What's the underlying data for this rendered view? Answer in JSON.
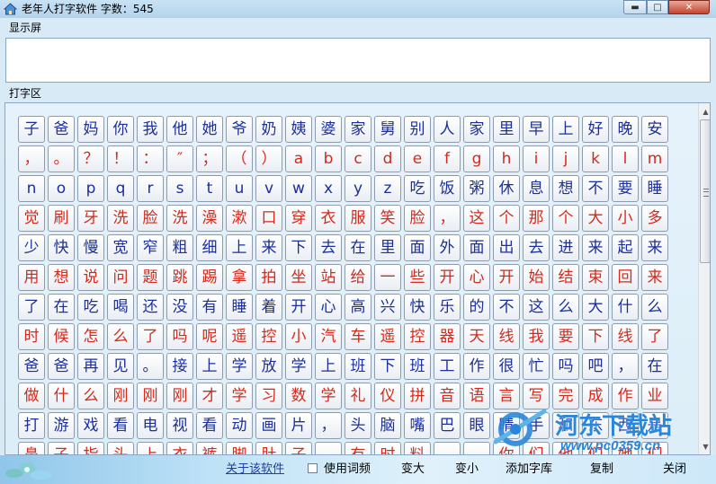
{
  "window": {
    "title": "老年人打字软件  字数：545",
    "min_glyph": "▬",
    "max_glyph": "□",
    "close_glyph": "✕"
  },
  "display_section": {
    "label": "显示屏",
    "text": ""
  },
  "typing_section": {
    "label": "打字区"
  },
  "keys": [
    {
      "t": "子",
      "c": "blue"
    },
    {
      "t": "爸",
      "c": "blue"
    },
    {
      "t": "妈",
      "c": "blue"
    },
    {
      "t": "你",
      "c": "blue"
    },
    {
      "t": "我",
      "c": "blue"
    },
    {
      "t": "他",
      "c": "blue"
    },
    {
      "t": "她",
      "c": "blue"
    },
    {
      "t": "爷",
      "c": "blue"
    },
    {
      "t": "奶",
      "c": "blue"
    },
    {
      "t": "姨",
      "c": "blue"
    },
    {
      "t": "婆",
      "c": "blue"
    },
    {
      "t": "家",
      "c": "blue"
    },
    {
      "t": "舅",
      "c": "blue"
    },
    {
      "t": "别",
      "c": "blue"
    },
    {
      "t": "人",
      "c": "blue"
    },
    {
      "t": "家",
      "c": "blue"
    },
    {
      "t": "里",
      "c": "blue"
    },
    {
      "t": "早",
      "c": "blue"
    },
    {
      "t": "上",
      "c": "blue"
    },
    {
      "t": "好",
      "c": "blue"
    },
    {
      "t": "晚",
      "c": "blue"
    },
    {
      "t": "安",
      "c": "blue"
    },
    {
      "t": "，",
      "c": "red"
    },
    {
      "t": "。",
      "c": "red"
    },
    {
      "t": "？",
      "c": "red"
    },
    {
      "t": "！",
      "c": "red"
    },
    {
      "t": "：",
      "c": "red"
    },
    {
      "t": "″",
      "c": "red"
    },
    {
      "t": "；",
      "c": "red"
    },
    {
      "t": "（",
      "c": "red"
    },
    {
      "t": "）",
      "c": "red"
    },
    {
      "t": "a",
      "c": "red"
    },
    {
      "t": "b",
      "c": "red"
    },
    {
      "t": "c",
      "c": "red"
    },
    {
      "t": "d",
      "c": "red"
    },
    {
      "t": "e",
      "c": "red"
    },
    {
      "t": "f",
      "c": "red"
    },
    {
      "t": "g",
      "c": "red"
    },
    {
      "t": "h",
      "c": "red"
    },
    {
      "t": "i",
      "c": "red"
    },
    {
      "t": "j",
      "c": "red"
    },
    {
      "t": "k",
      "c": "red"
    },
    {
      "t": "l",
      "c": "red"
    },
    {
      "t": "m",
      "c": "red"
    },
    {
      "t": "n",
      "c": "blue"
    },
    {
      "t": "o",
      "c": "blue"
    },
    {
      "t": "p",
      "c": "blue"
    },
    {
      "t": "q",
      "c": "blue"
    },
    {
      "t": "r",
      "c": "blue"
    },
    {
      "t": "s",
      "c": "blue"
    },
    {
      "t": "t",
      "c": "blue"
    },
    {
      "t": "u",
      "c": "blue"
    },
    {
      "t": "v",
      "c": "blue"
    },
    {
      "t": "w",
      "c": "blue"
    },
    {
      "t": "x",
      "c": "blue"
    },
    {
      "t": "y",
      "c": "blue"
    },
    {
      "t": "z",
      "c": "blue"
    },
    {
      "t": "吃",
      "c": "blue"
    },
    {
      "t": "饭",
      "c": "blue"
    },
    {
      "t": "粥",
      "c": "blue"
    },
    {
      "t": "休",
      "c": "blue"
    },
    {
      "t": "息",
      "c": "blue"
    },
    {
      "t": "想",
      "c": "blue"
    },
    {
      "t": "不",
      "c": "blue"
    },
    {
      "t": "要",
      "c": "blue"
    },
    {
      "t": "睡",
      "c": "blue"
    },
    {
      "t": "觉",
      "c": "red"
    },
    {
      "t": "刷",
      "c": "red"
    },
    {
      "t": "牙",
      "c": "red"
    },
    {
      "t": "洗",
      "c": "red"
    },
    {
      "t": "脸",
      "c": "red"
    },
    {
      "t": "洗",
      "c": "red"
    },
    {
      "t": "澡",
      "c": "red"
    },
    {
      "t": "漱",
      "c": "red"
    },
    {
      "t": "口",
      "c": "red"
    },
    {
      "t": "穿",
      "c": "red"
    },
    {
      "t": "衣",
      "c": "red"
    },
    {
      "t": "服",
      "c": "red"
    },
    {
      "t": "笑",
      "c": "red"
    },
    {
      "t": "脸",
      "c": "red"
    },
    {
      "t": "，",
      "c": "red"
    },
    {
      "t": "这",
      "c": "red"
    },
    {
      "t": "个",
      "c": "red"
    },
    {
      "t": "那",
      "c": "red"
    },
    {
      "t": "个",
      "c": "red"
    },
    {
      "t": "大",
      "c": "red"
    },
    {
      "t": "小",
      "c": "red"
    },
    {
      "t": "多",
      "c": "red"
    },
    {
      "t": "少",
      "c": "blue"
    },
    {
      "t": "快",
      "c": "blue"
    },
    {
      "t": "慢",
      "c": "blue"
    },
    {
      "t": "宽",
      "c": "blue"
    },
    {
      "t": "窄",
      "c": "blue"
    },
    {
      "t": "粗",
      "c": "blue"
    },
    {
      "t": "细",
      "c": "blue"
    },
    {
      "t": "上",
      "c": "blue"
    },
    {
      "t": "来",
      "c": "blue"
    },
    {
      "t": "下",
      "c": "blue"
    },
    {
      "t": "去",
      "c": "blue"
    },
    {
      "t": "在",
      "c": "blue"
    },
    {
      "t": "里",
      "c": "blue"
    },
    {
      "t": "面",
      "c": "blue"
    },
    {
      "t": "外",
      "c": "blue"
    },
    {
      "t": "面",
      "c": "blue"
    },
    {
      "t": "出",
      "c": "blue"
    },
    {
      "t": "去",
      "c": "blue"
    },
    {
      "t": "进",
      "c": "blue"
    },
    {
      "t": "来",
      "c": "blue"
    },
    {
      "t": "起",
      "c": "blue"
    },
    {
      "t": "来",
      "c": "blue"
    },
    {
      "t": "用",
      "c": "red"
    },
    {
      "t": "想",
      "c": "red"
    },
    {
      "t": "说",
      "c": "red"
    },
    {
      "t": "问",
      "c": "red"
    },
    {
      "t": "题",
      "c": "red"
    },
    {
      "t": "跳",
      "c": "red"
    },
    {
      "t": "踢",
      "c": "red"
    },
    {
      "t": "拿",
      "c": "red"
    },
    {
      "t": "拍",
      "c": "red"
    },
    {
      "t": "坐",
      "c": "red"
    },
    {
      "t": "站",
      "c": "red"
    },
    {
      "t": "给",
      "c": "red"
    },
    {
      "t": "一",
      "c": "red"
    },
    {
      "t": "些",
      "c": "red"
    },
    {
      "t": "开",
      "c": "red"
    },
    {
      "t": "心",
      "c": "red"
    },
    {
      "t": "开",
      "c": "red"
    },
    {
      "t": "始",
      "c": "red"
    },
    {
      "t": "结",
      "c": "red"
    },
    {
      "t": "束",
      "c": "red"
    },
    {
      "t": "回",
      "c": "red"
    },
    {
      "t": "来",
      "c": "red"
    },
    {
      "t": "了",
      "c": "blue"
    },
    {
      "t": "在",
      "c": "blue"
    },
    {
      "t": "吃",
      "c": "blue"
    },
    {
      "t": "喝",
      "c": "blue"
    },
    {
      "t": "还",
      "c": "blue"
    },
    {
      "t": "没",
      "c": "blue"
    },
    {
      "t": "有",
      "c": "blue"
    },
    {
      "t": "睡",
      "c": "blue"
    },
    {
      "t": "着",
      "c": "blue"
    },
    {
      "t": "开",
      "c": "blue"
    },
    {
      "t": "心",
      "c": "blue"
    },
    {
      "t": "高",
      "c": "blue"
    },
    {
      "t": "兴",
      "c": "blue"
    },
    {
      "t": "快",
      "c": "blue"
    },
    {
      "t": "乐",
      "c": "blue"
    },
    {
      "t": "的",
      "c": "blue"
    },
    {
      "t": "不",
      "c": "blue"
    },
    {
      "t": "这",
      "c": "blue"
    },
    {
      "t": "么",
      "c": "blue"
    },
    {
      "t": "大",
      "c": "blue"
    },
    {
      "t": "什",
      "c": "blue"
    },
    {
      "t": "么",
      "c": "blue"
    },
    {
      "t": "时",
      "c": "red"
    },
    {
      "t": "候",
      "c": "red"
    },
    {
      "t": "怎",
      "c": "red"
    },
    {
      "t": "么",
      "c": "red"
    },
    {
      "t": "了",
      "c": "red"
    },
    {
      "t": "吗",
      "c": "red"
    },
    {
      "t": "呢",
      "c": "red"
    },
    {
      "t": "遥",
      "c": "red"
    },
    {
      "t": "控",
      "c": "red"
    },
    {
      "t": "小",
      "c": "red"
    },
    {
      "t": "汽",
      "c": "red"
    },
    {
      "t": "车",
      "c": "red"
    },
    {
      "t": "遥",
      "c": "red"
    },
    {
      "t": "控",
      "c": "red"
    },
    {
      "t": "器",
      "c": "red"
    },
    {
      "t": "天",
      "c": "red"
    },
    {
      "t": "线",
      "c": "red"
    },
    {
      "t": "我",
      "c": "red"
    },
    {
      "t": "要",
      "c": "red"
    },
    {
      "t": "下",
      "c": "red"
    },
    {
      "t": "线",
      "c": "red"
    },
    {
      "t": "了",
      "c": "red"
    },
    {
      "t": "爸",
      "c": "blue"
    },
    {
      "t": "爸",
      "c": "blue"
    },
    {
      "t": "再",
      "c": "blue"
    },
    {
      "t": "见",
      "c": "blue"
    },
    {
      "t": "。",
      "c": "blue"
    },
    {
      "t": "接",
      "c": "blue"
    },
    {
      "t": "上",
      "c": "blue"
    },
    {
      "t": "学",
      "c": "blue"
    },
    {
      "t": "放",
      "c": "blue"
    },
    {
      "t": "学",
      "c": "blue"
    },
    {
      "t": "上",
      "c": "blue"
    },
    {
      "t": "班",
      "c": "blue"
    },
    {
      "t": "下",
      "c": "blue"
    },
    {
      "t": "班",
      "c": "blue"
    },
    {
      "t": "工",
      "c": "blue"
    },
    {
      "t": "作",
      "c": "blue"
    },
    {
      "t": "很",
      "c": "blue"
    },
    {
      "t": "忙",
      "c": "blue"
    },
    {
      "t": "吗",
      "c": "blue"
    },
    {
      "t": "吧",
      "c": "blue"
    },
    {
      "t": "，",
      "c": "blue"
    },
    {
      "t": "在",
      "c": "blue"
    },
    {
      "t": "做",
      "c": "red"
    },
    {
      "t": "什",
      "c": "red"
    },
    {
      "t": "么",
      "c": "red"
    },
    {
      "t": "刚",
      "c": "red"
    },
    {
      "t": "刚",
      "c": "red"
    },
    {
      "t": "刚",
      "c": "red"
    },
    {
      "t": "才",
      "c": "red"
    },
    {
      "t": "学",
      "c": "red"
    },
    {
      "t": "习",
      "c": "red"
    },
    {
      "t": "数",
      "c": "red"
    },
    {
      "t": "学",
      "c": "red"
    },
    {
      "t": "礼",
      "c": "red"
    },
    {
      "t": "仪",
      "c": "red"
    },
    {
      "t": "拼",
      "c": "red"
    },
    {
      "t": "音",
      "c": "red"
    },
    {
      "t": "语",
      "c": "red"
    },
    {
      "t": "言",
      "c": "red"
    },
    {
      "t": "写",
      "c": "red"
    },
    {
      "t": "完",
      "c": "red"
    },
    {
      "t": "成",
      "c": "red"
    },
    {
      "t": "作",
      "c": "red"
    },
    {
      "t": "业",
      "c": "red"
    },
    {
      "t": "打",
      "c": "blue"
    },
    {
      "t": "游",
      "c": "blue"
    },
    {
      "t": "戏",
      "c": "blue"
    },
    {
      "t": "看",
      "c": "blue"
    },
    {
      "t": "电",
      "c": "blue"
    },
    {
      "t": "视",
      "c": "blue"
    },
    {
      "t": "看",
      "c": "blue"
    },
    {
      "t": "动",
      "c": "blue"
    },
    {
      "t": "画",
      "c": "blue"
    },
    {
      "t": "片",
      "c": "blue"
    },
    {
      "t": "，",
      "c": "blue"
    },
    {
      "t": "头",
      "c": "blue"
    },
    {
      "t": "脑",
      "c": "blue"
    },
    {
      "t": "嘴",
      "c": "blue"
    },
    {
      "t": "巴",
      "c": "blue"
    },
    {
      "t": "眼",
      "c": "blue"
    },
    {
      "t": "睛",
      "c": "blue"
    },
    {
      "t": "手",
      "c": "blue"
    },
    {
      "t": "和",
      "c": "blue"
    },
    {
      "t": "东",
      "c": "blue"
    },
    {
      "t": "西",
      "c": "blue"
    },
    {
      "t": "是",
      "c": "blue"
    },
    {
      "t": "鼻",
      "c": "red"
    },
    {
      "t": "子",
      "c": "red"
    },
    {
      "t": "指",
      "c": "red"
    },
    {
      "t": "头",
      "c": "red"
    },
    {
      "t": "上",
      "c": "red"
    },
    {
      "t": "衣",
      "c": "red"
    },
    {
      "t": "裤",
      "c": "red"
    },
    {
      "t": "脚",
      "c": "red"
    },
    {
      "t": "肚",
      "c": "red"
    },
    {
      "t": "子",
      "c": "red"
    },
    {
      "t": "，",
      "c": "red"
    },
    {
      "t": "有",
      "c": "red"
    },
    {
      "t": "时",
      "c": "red"
    },
    {
      "t": "料",
      "c": "red"
    },
    {
      "t": "，",
      "c": "red"
    },
    {
      "t": "。",
      "c": "red"
    },
    {
      "t": "你",
      "c": "red"
    },
    {
      "t": "们",
      "c": "red"
    },
    {
      "t": "他",
      "c": "red"
    },
    {
      "t": "们",
      "c": "red"
    },
    {
      "t": "她",
      "c": "red"
    },
    {
      "t": "们",
      "c": "red"
    }
  ],
  "bottom_bar": {
    "about": "关于该软件",
    "use_phrases": "使用词频",
    "use_phrases_checked": false,
    "enlarge": "变大",
    "shrink": "变小",
    "add_library": "添加字库",
    "copy": "复制",
    "close": "关闭"
  },
  "watermark": {
    "title": "河东下载站",
    "url": "www.pc0359.cn"
  },
  "colors": {
    "blue_key": "#1c2f9c",
    "red_key": "#d22a1c",
    "watermark": "#2a86d8"
  }
}
